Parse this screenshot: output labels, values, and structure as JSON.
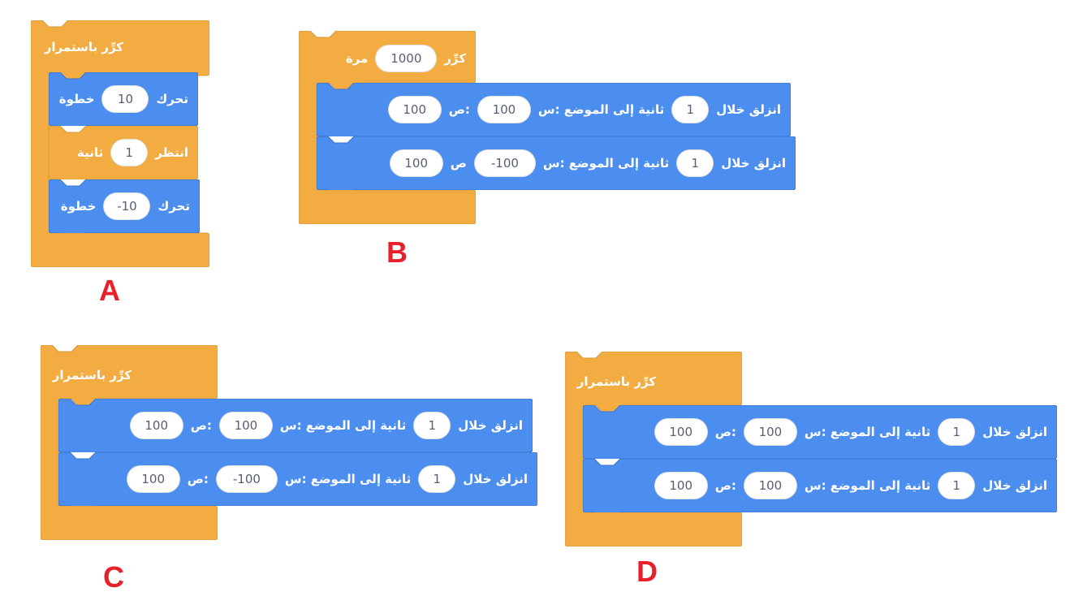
{
  "colors": {
    "control": "#f2ac42",
    "control_edge": "#d69a38",
    "motion": "#4c8ef0",
    "motion_edge": "#3d74c8",
    "letter": "#e8202a"
  },
  "group_a": {
    "letter": "A",
    "header": "كرِّر باستمرار",
    "b1": {
      "word": "تحرك",
      "value": "10",
      "unit": "خطوة"
    },
    "b2": {
      "word": "انتظر",
      "value": "1",
      "unit": "ثانية"
    },
    "b3": {
      "word": "تحرك",
      "value": "-10",
      "unit": "خطوة"
    }
  },
  "group_b": {
    "letter": "B",
    "header": {
      "word": "كرِّر",
      "value": "1000",
      "unit": "مرة"
    },
    "b1": {
      "word": "انزلق خلال",
      "secs": "1",
      "mid": "ثانية إلى الموضع :س",
      "x": "100",
      "ylabel": ":ص",
      "y": "100"
    },
    "b2": {
      "word": "انزلق خلال",
      "secs": "1",
      "mid": "ثانية إلى الموضع :س",
      "x": "-100",
      "ylabel": "ص",
      "y": "100"
    }
  },
  "group_c": {
    "letter": "C",
    "header": "كرِّر باستمرار",
    "b1": {
      "word": "انزلق خلال",
      "secs": "1",
      "mid": "ثانية إلى الموضع :س",
      "x": "100",
      "ylabel": ":ص",
      "y": "100"
    },
    "b2": {
      "word": "انزلق خلال",
      "secs": "1",
      "mid": "ثانية إلى الموضع :س",
      "x": "-100",
      "ylabel": ":ص",
      "y": "100"
    }
  },
  "group_d": {
    "letter": "D",
    "header": "كرِّر باستمرار",
    "b1": {
      "word": "انزلق خلال",
      "secs": "1",
      "mid": "ثانية إلى الموضع :س",
      "x": "100",
      "ylabel": ":ص",
      "y": "100"
    },
    "b2": {
      "word": "انزلق خلال",
      "secs": "1",
      "mid": "ثانية إلى الموضع :س",
      "x": "100",
      "ylabel": ":ص",
      "y": "100"
    }
  }
}
